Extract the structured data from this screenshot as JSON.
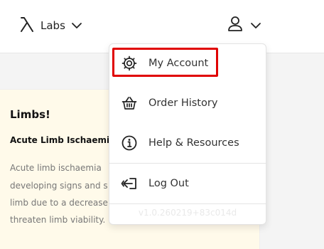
{
  "header": {
    "brand_label": "Labs",
    "icons": {
      "brand": "lambda-logo-icon",
      "brand_caret": "chevron-down-icon",
      "user": "user-icon",
      "user_caret": "chevron-down-icon"
    }
  },
  "card": {
    "title": "Limbs!",
    "subtitle": "Acute Limb Ischaemia",
    "lines": [
      "Acute limb ischaemia",
      "developing signs and s",
      "limb due to a decrease",
      "threaten limb viability."
    ]
  },
  "dropdown": {
    "items": [
      {
        "label": "My Account",
        "icon": "gear-icon"
      },
      {
        "label": "Order History",
        "icon": "basket-icon"
      },
      {
        "label": "Help & Resources",
        "icon": "info-icon"
      },
      {
        "label": "Log Out",
        "icon": "logout-icon"
      }
    ],
    "version": "v1.0.260219+83c014d"
  },
  "colors": {
    "highlight": "#e00000",
    "card_background": "#fffaea",
    "page_background": "#f4f4f4"
  }
}
